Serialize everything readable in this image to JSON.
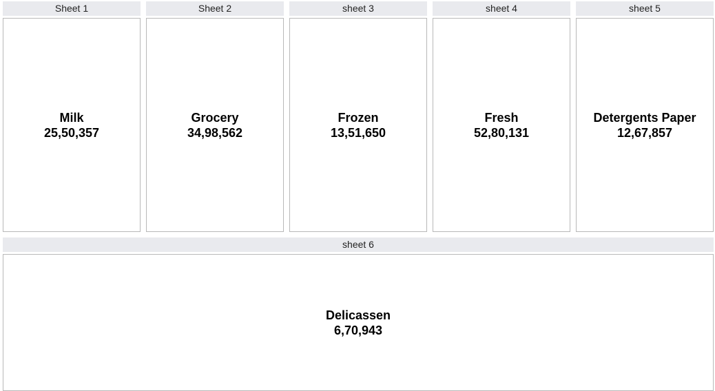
{
  "sheets": [
    {
      "tab": "Sheet 1",
      "name": "Milk",
      "value": "25,50,357"
    },
    {
      "tab": "Sheet 2",
      "name": "Grocery",
      "value": "34,98,562"
    },
    {
      "tab": "sheet 3",
      "name": "Frozen",
      "value": "13,51,650"
    },
    {
      "tab": "sheet 4",
      "name": "Fresh",
      "value": "52,80,131"
    },
    {
      "tab": "sheet 5",
      "name": "Detergents Paper",
      "value": "12,67,857"
    },
    {
      "tab": "sheet 6",
      "name": "Delicassen",
      "value": "6,70,943"
    }
  ],
  "colors": {
    "tab_background": "#e9eaee",
    "card_border": "#b8b8b8",
    "text": "#000000"
  }
}
